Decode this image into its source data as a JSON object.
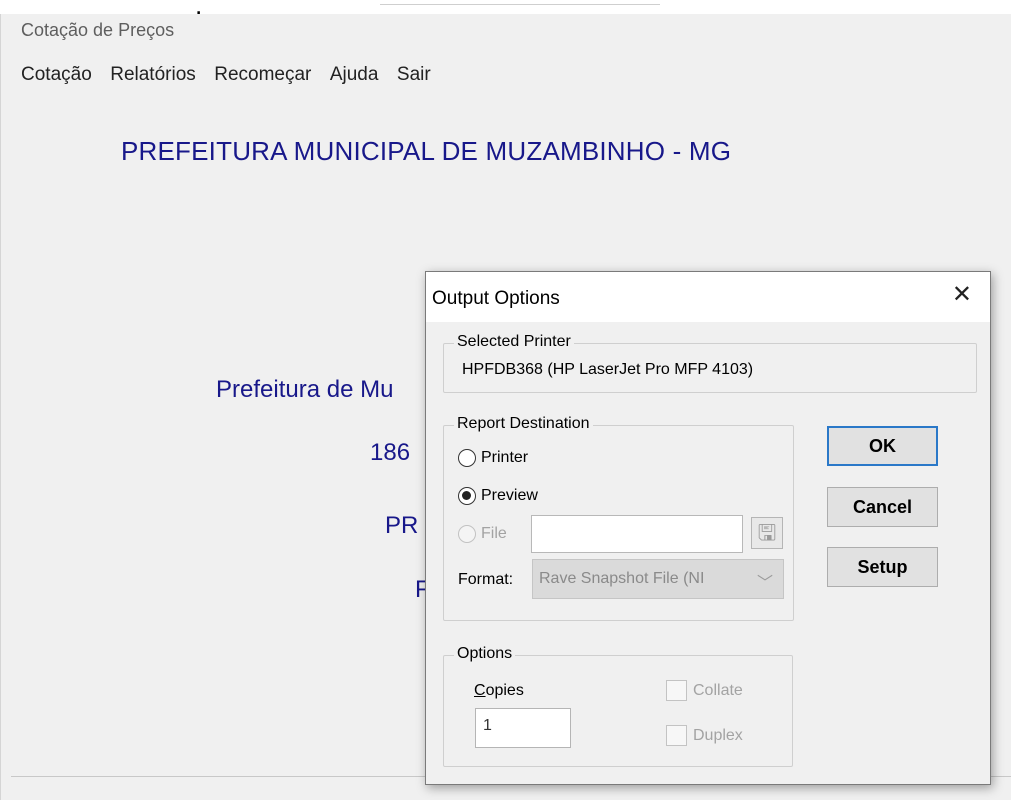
{
  "window": {
    "title": "Cotação de Preços",
    "menu": [
      "Cotação",
      "Relatórios",
      "Recomeçar",
      "Ajuda",
      "Sair"
    ]
  },
  "main": {
    "heading": "PREFEITURA MUNICIPAL DE MUZAMBINHO - MG",
    "line1": "Prefeitura de Mu",
    "line2": "186",
    "line3": "PR",
    "line4": "F"
  },
  "dialog": {
    "title": "Output Options",
    "selected_printer_label": "Selected Printer",
    "printer_name": "HPFDB368 (HP LaserJet Pro MFP 4103)",
    "report_destination_label": "Report Destination",
    "destinations": [
      {
        "label": "Printer",
        "checked": false,
        "enabled": true
      },
      {
        "label": "Preview",
        "checked": true,
        "enabled": true
      },
      {
        "label": "File",
        "checked": false,
        "enabled": false
      }
    ],
    "file_value": "",
    "format_label": "Format:",
    "format_value": "Rave Snapshot File (NI",
    "buttons": {
      "ok": "OK",
      "cancel": "Cancel",
      "setup": "Setup"
    },
    "options_label": "Options",
    "copies_label_underlined": "C",
    "copies_label_rest": "opies",
    "copies_value": "1",
    "collate_label": "Collate",
    "collate_checked": false,
    "duplex_label": "Duplex",
    "duplex_checked": false
  },
  "colors": {
    "main_text": "#18188a",
    "ok_focus_border": "#2a78c8"
  }
}
